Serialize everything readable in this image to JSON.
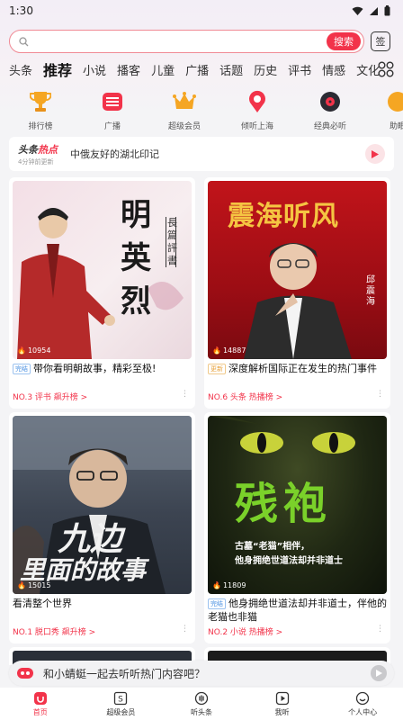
{
  "status": {
    "time": "1:30"
  },
  "search": {
    "placeholder": "",
    "button_label": "搜索",
    "sign_label": "签"
  },
  "tabs": [
    {
      "label": "头条"
    },
    {
      "label": "推荐",
      "active": true
    },
    {
      "label": "小说"
    },
    {
      "label": "播客"
    },
    {
      "label": "儿童"
    },
    {
      "label": "广播"
    },
    {
      "label": "话题"
    },
    {
      "label": "历史"
    },
    {
      "label": "评书"
    },
    {
      "label": "情感"
    },
    {
      "label": "文化"
    }
  ],
  "quick_links": [
    {
      "label": "排行榜",
      "icon": "trophy-icon"
    },
    {
      "label": "广播",
      "icon": "radio-icon"
    },
    {
      "label": "超级会员",
      "icon": "crown-icon"
    },
    {
      "label": "倾听上海",
      "icon": "location-pin-icon"
    },
    {
      "label": "经典必听",
      "icon": "vinyl-icon"
    },
    {
      "label": "助眠",
      "icon": "moon-icon"
    }
  ],
  "hot_news": {
    "logo_prefix": "头条",
    "logo_highlight": "热点",
    "update_text": "4分钟前更新",
    "headline": "中俄友好的湖北印记"
  },
  "cards": [
    {
      "cover_text": [
        "明",
        "英",
        "烈"
      ],
      "cover_side": "長篇評書",
      "plays": "10954",
      "badge": "完结",
      "title": "带你看明朝故事，精彩至极!",
      "rank": "NO.3 评书 飙升榜 >"
    },
    {
      "cover_text": [
        "震海听风"
      ],
      "cover_side": "邱震海",
      "plays": "14887",
      "badge": "更新",
      "title": "深度解析国际正在发生的热门事件",
      "rank": "NO.6 头条 热播榜 >"
    },
    {
      "cover_text": [
        "九边",
        "里面的故事"
      ],
      "plays": "15015",
      "badge": "",
      "title": "看清整个世界",
      "rank": "NO.1 脱口秀 飙升榜 >"
    },
    {
      "cover_text": [
        "残袍",
        "古墓“老猫”相伴，",
        "他身拥绝世道法却并非道士"
      ],
      "plays": "11809",
      "badge": "完结",
      "title": "他身拥绝世道法却并非道士，伴他的老猫也非猫",
      "rank": "NO.2 小说 热播榜 >"
    }
  ],
  "banner": {
    "text": "和小蜻蜓一起去听听热门内容吧？"
  },
  "nav": [
    {
      "label": "首页",
      "icon": "home-icon",
      "active": true
    },
    {
      "label": "超级会员",
      "icon": "vip-icon"
    },
    {
      "label": "听头条",
      "icon": "headline-icon"
    },
    {
      "label": "我听",
      "icon": "play-square-icon"
    },
    {
      "label": "个人中心",
      "icon": "profile-icon"
    }
  ],
  "colors": {
    "accent": "#f2334a",
    "background": "#f4f4f6"
  }
}
